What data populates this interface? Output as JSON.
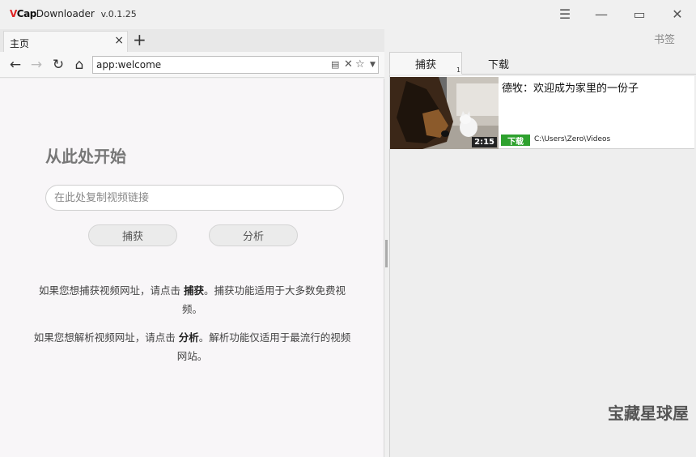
{
  "app": {
    "title_logo": "VCap",
    "title_suffix": "Downloader",
    "version": "v.0.1.25"
  },
  "window": {
    "menu_glyph": "☰",
    "min_glyph": "—",
    "max_glyph": "▭",
    "close_glyph": "✕"
  },
  "tabs": [
    {
      "label": "主页",
      "close": "×"
    }
  ],
  "tab_add": "+",
  "bookmarks_label": "书签",
  "nav": {
    "back": "←",
    "forward": "→",
    "reload": "↻",
    "home": "⌂",
    "address": "app:welcome",
    "page_icon": "▤",
    "clear_icon": "✕",
    "star_icon": "☆",
    "dropdown_icon": "▼"
  },
  "welcome": {
    "title": "从此处开始",
    "input_placeholder": "在此处复制视频链接",
    "input_value": "",
    "capture_button": "捕获",
    "analyze_button": "分析",
    "hint1_pre": "如果您想捕获视频网址，请点击",
    "hint1_bold": "捕获",
    "hint1_post": "。捕获功能适用于大多数免费视频。",
    "hint2_pre": "如果您想解析视频网址，请点击",
    "hint2_bold": "分析",
    "hint2_post": "。解析功能仅适用于最流行的视频网站。"
  },
  "right_tabs": {
    "capture": "捕获",
    "capture_count": "1",
    "download": "下载"
  },
  "captures": [
    {
      "title": "德牧：欢迎成为家里的一份子",
      "duration": "2:15",
      "action": "下载",
      "path": "C:\\Users\\Zero\\Videos"
    }
  ],
  "watermark": "宝藏星球屋",
  "colors": {
    "accent_red": "#dd2222",
    "download_green": "#2ea12e"
  }
}
